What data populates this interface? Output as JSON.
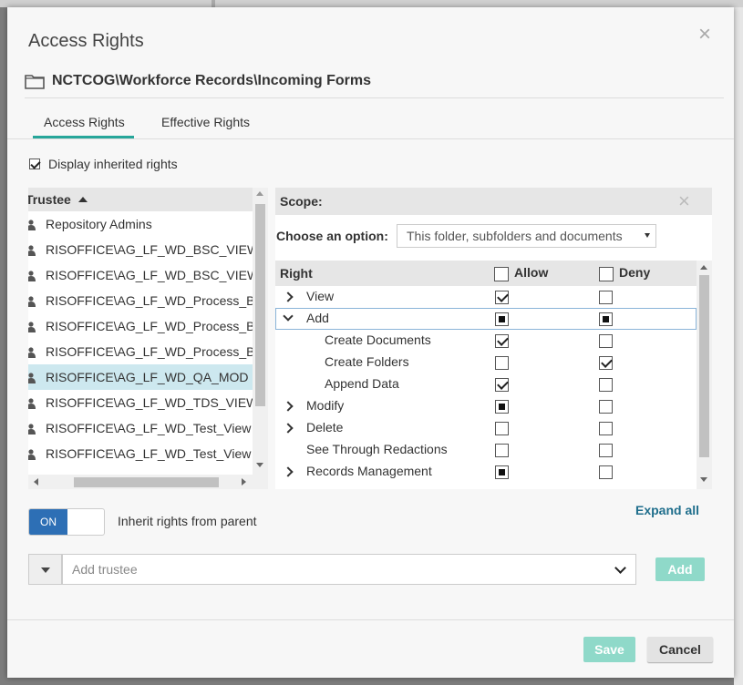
{
  "dialog": {
    "title": "Access Rights",
    "path": "NCTCOG\\Workforce Records\\Incoming Forms"
  },
  "tabs": [
    {
      "label": "Access Rights",
      "active": true
    },
    {
      "label": "Effective Rights",
      "active": false
    }
  ],
  "display_inherited": {
    "label": "Display inherited rights",
    "checked": true
  },
  "trustee_panel": {
    "header": "Trustee",
    "items": [
      {
        "name": "Repository Admins",
        "selected": false
      },
      {
        "name": "RISOFFICE\\AG_LF_WD_BSC_VIEW",
        "selected": false
      },
      {
        "name": "RISOFFICE\\AG_LF_WD_BSC_VIEW",
        "selected": false
      },
      {
        "name": "RISOFFICE\\AG_LF_WD_Process_Builder",
        "selected": false
      },
      {
        "name": "RISOFFICE\\AG_LF_WD_Process_Builder",
        "selected": false
      },
      {
        "name": "RISOFFICE\\AG_LF_WD_Process_Builder",
        "selected": false
      },
      {
        "name": "RISOFFICE\\AG_LF_WD_QA_MOD",
        "selected": true
      },
      {
        "name": "RISOFFICE\\AG_LF_WD_TDS_VIEW",
        "selected": false
      },
      {
        "name": "RISOFFICE\\AG_LF_WD_Test_View",
        "selected": false
      },
      {
        "name": "RISOFFICE\\AG_LF_WD_Test_View",
        "selected": false
      }
    ]
  },
  "scope_panel": {
    "title": "Scope:",
    "choose_label": "Choose an option:",
    "selected_option": "This folder, subfolders and documents",
    "columns": {
      "right": "Right",
      "allow": "Allow",
      "deny": "Deny"
    },
    "rights": [
      {
        "label": "View",
        "expander": "collapsed",
        "indent": 0,
        "allow": "checked",
        "deny": "none"
      },
      {
        "label": "Add",
        "expander": "expanded",
        "indent": 0,
        "allow": "partial",
        "deny": "partial",
        "focused": true
      },
      {
        "label": "Create Documents",
        "expander": "none",
        "indent": 1,
        "allow": "checked",
        "deny": "none"
      },
      {
        "label": "Create Folders",
        "expander": "none",
        "indent": 1,
        "allow": "none",
        "deny": "checked"
      },
      {
        "label": "Append Data",
        "expander": "none",
        "indent": 1,
        "allow": "checked",
        "deny": "none"
      },
      {
        "label": "Modify",
        "expander": "collapsed",
        "indent": 0,
        "allow": "partial",
        "deny": "none"
      },
      {
        "label": "Delete",
        "expander": "collapsed",
        "indent": 0,
        "allow": "none",
        "deny": "none"
      },
      {
        "label": "See Through Redactions",
        "expander": "none",
        "indent": 0,
        "allow": "none",
        "deny": "none"
      },
      {
        "label": "Records Management",
        "expander": "collapsed",
        "indent": 0,
        "allow": "partial",
        "deny": "none"
      }
    ]
  },
  "expand_all": "Expand all",
  "inherit": {
    "toggle_label": "ON",
    "label": "Inherit rights from parent",
    "on": true
  },
  "add_trustee": {
    "placeholder": "Add trustee",
    "button": "Add"
  },
  "footer": {
    "save": "Save",
    "cancel": "Cancel"
  },
  "colors": {
    "accent": "#26a69a",
    "toggle_on": "#2d6fb5",
    "link": "#1f6e8c",
    "button_disabled": "#8fd9c9",
    "selected_row": "#cde8ef"
  }
}
